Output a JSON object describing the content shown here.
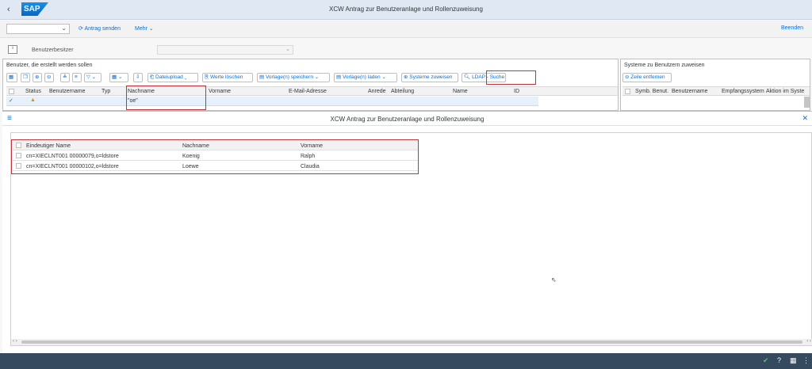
{
  "shell": {
    "title": "XCW Antrag zur Benutzeranlage und Rollenzuweisung",
    "logo": "SAP",
    "back_icon": "‹"
  },
  "toolbar": {
    "send_label": "Antrag senden",
    "more_label": "Mehr",
    "exit_label": "Beenden",
    "command_value": ""
  },
  "owner": {
    "label": "Benutzerbesitzer",
    "value": ""
  },
  "left_panel": {
    "title": "Benutzer, die erstellt werden sollen",
    "buttons": {
      "file_upload": "Dateiupload",
      "clear_values": "Werte löschen",
      "save_template": "Vorlage(n) speichern",
      "load_template": "Vorlage(n) laden",
      "assign_systems": "Systeme zuweisen",
      "ldap_search": "LDAP - Suche"
    },
    "columns": [
      "Status",
      "Benutzername",
      "Typ",
      "Nachname",
      "Vorname",
      "E-Mail-Adresse",
      "Anrede",
      "Abteilung",
      "Name",
      "ID"
    ],
    "row": {
      "status_icon": "warning-triangle",
      "nachname": "\"oe\""
    }
  },
  "right_panel": {
    "title": "Systeme zu Benutzern zuweisen",
    "remove_row_label": "Zeile entfernen",
    "columns": [
      "Symb. Benut.",
      "Benutzername",
      "Empfangssystem",
      "Aktion im Syste"
    ]
  },
  "dialog": {
    "title": "XCW Antrag zur Benutzeranlage und Rollenzuweisung",
    "columns": [
      "Eindeutiger Name",
      "Nachname",
      "Vorname"
    ],
    "rows": [
      {
        "name": "cn=XIECLNT001 00000079,o=ldstore",
        "nachname": "Koenig",
        "vorname": "Ralph"
      },
      {
        "name": "cn=XIECLNT001 00000102,o=ldstore",
        "nachname": "Loewe",
        "vorname": "Claudia"
      }
    ]
  },
  "colors": {
    "highlight": "#c0353d",
    "footer": "#354a5f",
    "link": "#0a6ed1"
  }
}
